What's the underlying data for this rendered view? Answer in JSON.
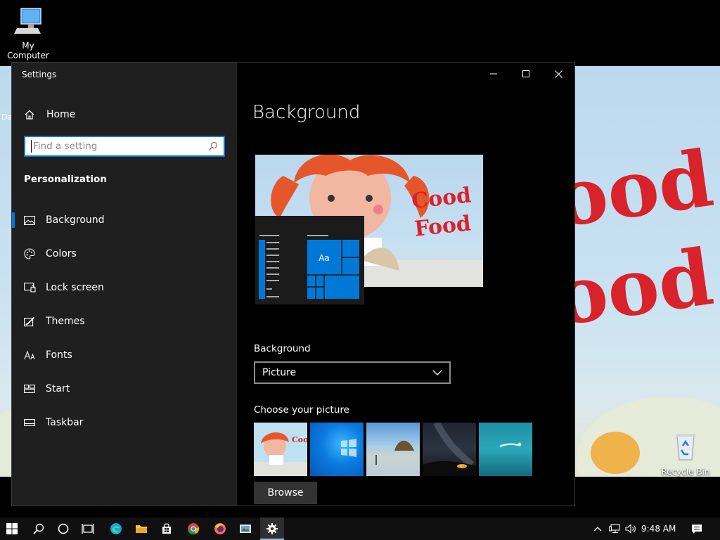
{
  "desktop": {
    "icons": [
      {
        "label": "My Computer",
        "icon": "computer-icon"
      },
      {
        "label": "Recycle Bin",
        "icon": "recycle-bin-icon"
      }
    ],
    "partial_label": "Da",
    "wallpaper_text": [
      "ood",
      "ood"
    ]
  },
  "window": {
    "app_title": "Settings",
    "controls": {
      "minimize": "minimize-icon",
      "maximize": "maximize-icon",
      "close": "close-icon"
    }
  },
  "nav": {
    "home_label": "Home",
    "search_placeholder": "Find a setting",
    "section_title": "Personalization",
    "items": [
      {
        "label": "Background",
        "icon": "picture-icon",
        "selected": true
      },
      {
        "label": "Colors",
        "icon": "palette-icon",
        "selected": false
      },
      {
        "label": "Lock screen",
        "icon": "lock-screen-icon",
        "selected": false
      },
      {
        "label": "Themes",
        "icon": "themes-icon",
        "selected": false
      },
      {
        "label": "Fonts",
        "icon": "fonts-icon",
        "selected": false
      },
      {
        "label": "Start",
        "icon": "start-icon",
        "selected": false
      },
      {
        "label": "Taskbar",
        "icon": "taskbar-icon",
        "selected": false
      }
    ]
  },
  "main": {
    "title": "Background",
    "preview": {
      "wallpaper_text": [
        "Cood",
        "Food"
      ],
      "tile_text": "Aa"
    },
    "background_label": "Background",
    "background_value": "Picture",
    "choose_label": "Choose your picture",
    "thumbnails": [
      {
        "name": "thumb-good-food",
        "text": "Coo Foo"
      },
      {
        "name": "thumb-windows"
      },
      {
        "name": "thumb-beach"
      },
      {
        "name": "thumb-night-sky"
      },
      {
        "name": "thumb-underwater"
      }
    ],
    "browse_label": "Browse"
  },
  "taskbar": {
    "apps": [
      "start-icon",
      "search-icon",
      "cortana-icon",
      "task-view-icon",
      "edge-icon",
      "file-explorer-icon",
      "store-icon",
      "chrome-icon",
      "firefox-icon",
      "photos-icon",
      "settings-gear-icon"
    ],
    "active_app": "settings-gear-icon",
    "time": "9:48 AM"
  },
  "colors": {
    "accent": "#0078d7",
    "nav_bg": "#1f1f1f",
    "content_bg": "#000000",
    "taskbar_bg": "#101010"
  }
}
